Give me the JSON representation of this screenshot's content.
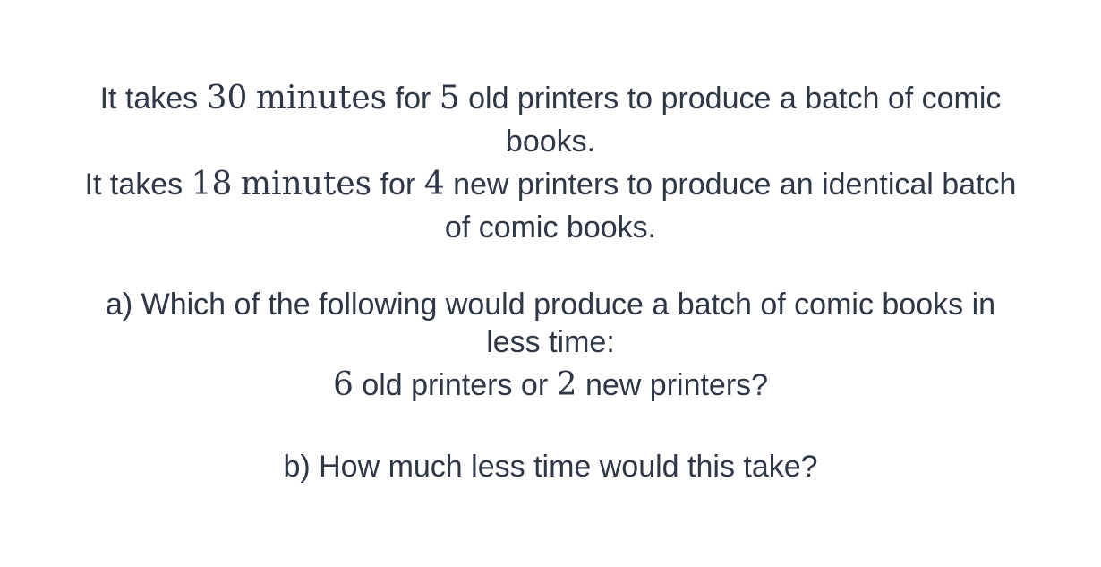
{
  "problem": {
    "intro": {
      "line1": {
        "t1": "It takes ",
        "m1": "30",
        "t2": " ",
        "m2": "minutes",
        "t3": " for ",
        "m3": "5",
        "t4": " old printers to produce a batch of comic"
      },
      "line2": "books.",
      "line3": {
        "t1": "It takes ",
        "m1": "18",
        "t2": " ",
        "m2": "minutes",
        "t3": " for ",
        "m3": "4",
        "t4": " new printers to produce an identical batch"
      },
      "line4": "of comic books."
    },
    "question_a": {
      "line1": "a) Which of the following would produce a batch of comic books in",
      "line2": "less time:",
      "line3": {
        "m1": "6",
        "t1": " old printers or ",
        "m2": "2",
        "t2": " new printers?"
      }
    },
    "question_b": "b) How much less time would this take?"
  }
}
